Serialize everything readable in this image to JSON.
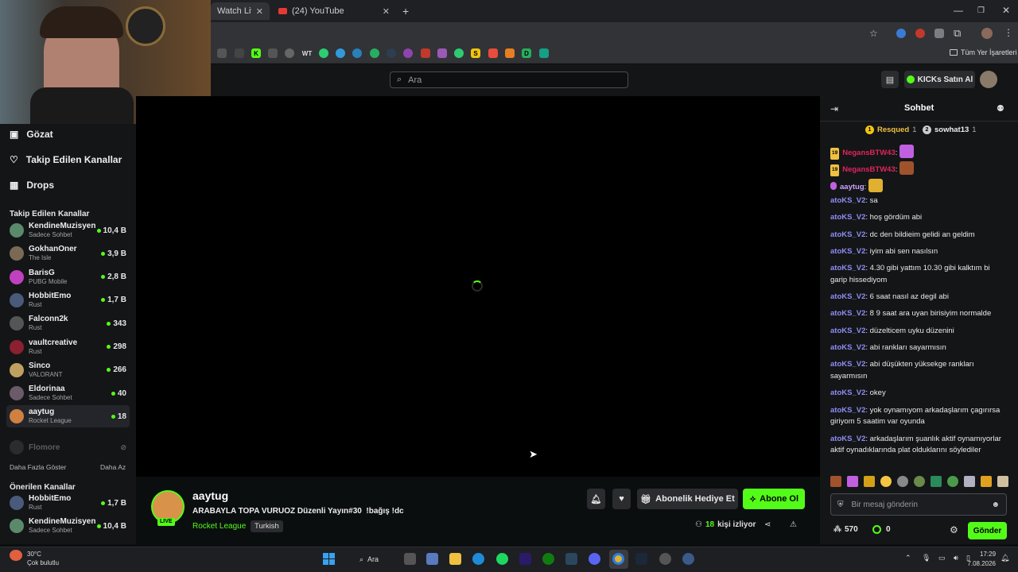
{
  "browser": {
    "tabs": [
      {
        "title": "Watch Live on"
      },
      {
        "title": "(24) YouTube"
      }
    ],
    "bookmarks_folder": "Tüm Yer İşaretleri",
    "bookmark_labels": [
      "WT",
      "D"
    ]
  },
  "header": {
    "search_placeholder": "Ara",
    "kicks_button": "KICKs Satın Al"
  },
  "sidebar": {
    "nav": [
      {
        "label": "Gözat"
      },
      {
        "label": "Takip Edilen Kanallar"
      },
      {
        "label": "Drops"
      }
    ],
    "following_title": "Takip Edilen Kanallar",
    "following": [
      {
        "name": "KendineMuzisyen",
        "game": "Sadece Sohbet",
        "viewers": "10,4 B",
        "color": "#5a8a6a"
      },
      {
        "name": "GokhanOner",
        "game": "The Isle",
        "viewers": "3,9 B",
        "color": "#7a6a55"
      },
      {
        "name": "BarisG",
        "game": "PUBG Mobile",
        "viewers": "2,8 B",
        "color": "#c040c0"
      },
      {
        "name": "HobbitEmo",
        "game": "Rust",
        "viewers": "1,7 B",
        "color": "#4a5a7a"
      },
      {
        "name": "Falconn2k",
        "game": "Rust",
        "viewers": "343",
        "color": "#555"
      },
      {
        "name": "vaultcreative",
        "game": "Rust",
        "viewers": "298",
        "color": "#8a2030"
      },
      {
        "name": "Sinco",
        "game": "VALORANT",
        "viewers": "266",
        "color": "#c0a060"
      },
      {
        "name": "Eldorinaa",
        "game": "Sadece Sohbet",
        "viewers": "40",
        "color": "#6a5a6a"
      },
      {
        "name": "aaytug",
        "game": "Rocket League",
        "viewers": "18",
        "color": "#d08040"
      }
    ],
    "offline": "Flomore",
    "show_more": "Daha Fazla Göster",
    "show_less": "Daha Az",
    "recommended_title": "Önerilen Kanallar",
    "recommended": [
      {
        "name": "HobbitEmo",
        "game": "Rust",
        "viewers": "1,7 B",
        "color": "#4a5a7a"
      },
      {
        "name": "KendineMuzisyen",
        "game": "Sadece Sohbet",
        "viewers": "10,4 B",
        "color": "#5a8a6a"
      }
    ]
  },
  "stream": {
    "channel": "aaytug",
    "live_badge": "LIVE",
    "title": "ARABAYLA TOPA VURUOZ Düzenli Yayın#30  !bağış !dc",
    "category": "Rocket League",
    "tag": "Turkish",
    "gift_button": "Abonelik Hediye Et",
    "subscribe_button": "Abone Ol",
    "viewers_count": "18",
    "viewers_label": "kişi izliyor"
  },
  "chat": {
    "title": "Sohbet",
    "top_gifters": [
      {
        "name": "Resqued",
        "count": "1",
        "rank": "1"
      },
      {
        "name": "sowhat13",
        "count": "1",
        "rank": "2"
      }
    ],
    "messages": [
      {
        "user": "NegansBTW43",
        "text": "",
        "style": "red",
        "badge": "19"
      },
      {
        "user": "NegansBTW43",
        "text": "",
        "style": "red",
        "badge": "19"
      },
      {
        "user": "aaytug",
        "text": "",
        "style": "purple",
        "badge": ""
      },
      {
        "user": "atoKS_V2",
        "text": "sa"
      },
      {
        "user": "atoKS_V2",
        "text": "hoş gördüm abi"
      },
      {
        "user": "atoKS_V2",
        "text": "dc den bildieim gelidi an geldim"
      },
      {
        "user": "atoKS_V2",
        "text": "iyim abi sen nasılsın"
      },
      {
        "user": "atoKS_V2",
        "text": "4.30 gibi yattım 10.30 gibi kalktım bi garip hissediyom"
      },
      {
        "user": "atoKS_V2",
        "text": "6 saat nasıl az degil abi"
      },
      {
        "user": "atoKS_V2",
        "text": "8 9 saat ara uyan birisiyim normalde"
      },
      {
        "user": "atoKS_V2",
        "text": "düzelticem uyku düzenini"
      },
      {
        "user": "atoKS_V2",
        "text": "abi rankları sayarmısın"
      },
      {
        "user": "atoKS_V2",
        "text": "abi düşükten yüksekge rankları sayarmısın"
      },
      {
        "user": "atoKS_V2",
        "text": "okey"
      },
      {
        "user": "atoKS_V2",
        "text": "yok oynamıyom arkadaşlarım çagırırsa giriyom 5 saatim var oyunda"
      },
      {
        "user": "atoKS_V2",
        "text": "arkadaşlarım şuanlık aktif oynamıyorlar aktif oynadıklarında plat olduklarını söylediler"
      }
    ],
    "input_placeholder": "Bir mesaj gönderin",
    "points": "570",
    "kicks": "0",
    "send_button": "Gönder"
  },
  "taskbar": {
    "weather_temp": "30°C",
    "weather_desc": "Çok bulutlu",
    "search_label": "Ara",
    "time": "17:29",
    "date": "7.08.2026"
  },
  "colors": {
    "kick_green": "#53fc18",
    "chat_user": "#8e8ef5",
    "background": "#0b0e0f"
  }
}
